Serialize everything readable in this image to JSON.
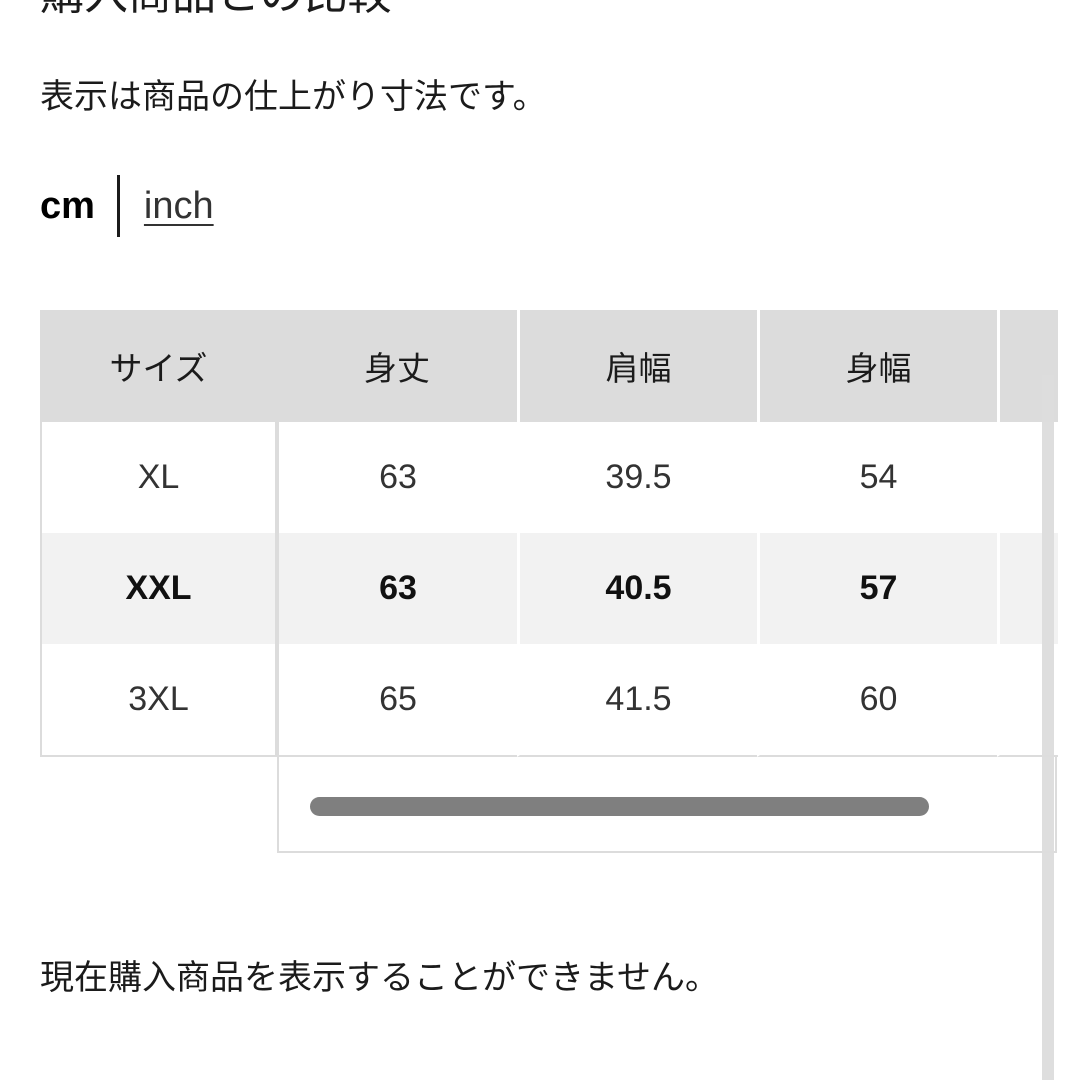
{
  "page": {
    "heading": "購入商品との比較",
    "subtitle": "表示は商品の仕上がり寸法です。",
    "message": "現在購入商品を表示することができません。"
  },
  "units": {
    "selected": "cm",
    "cm_label": "cm",
    "inch_label": "inch"
  },
  "size_table": {
    "headers": [
      "サイズ",
      "身丈",
      "肩幅",
      "身幅",
      ""
    ],
    "highlighted_row": "XXL",
    "rows": [
      {
        "size": "XL",
        "values": [
          "63",
          "39.5",
          "54",
          ""
        ]
      },
      {
        "size": "XXL",
        "values": [
          "63",
          "40.5",
          "57",
          ""
        ]
      },
      {
        "size": "3XL",
        "values": [
          "65",
          "41.5",
          "60",
          ""
        ]
      }
    ]
  },
  "colors": {
    "header_bg": "#dcdcdc",
    "highlight_row_bg": "#f2f2f2",
    "border": "#dcdcdc",
    "scroll_thumb": "#7f7f7f",
    "text": "#1b1b1b"
  },
  "scrollbars": {
    "horizontal_icon": "horizontal-scroll-thumb",
    "vertical_icon": "vertical-scroll-thumb"
  }
}
